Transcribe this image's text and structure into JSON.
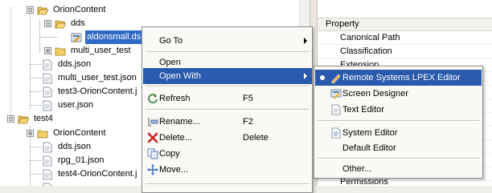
{
  "tree": {
    "items": [
      {
        "label": "OrionContent",
        "expander": "⊟",
        "icon": "folder-open-icon"
      },
      {
        "label": "dds",
        "expander": "⊟",
        "icon": "folder-open-icon"
      },
      {
        "label": "aldonsmall.ds",
        "icon": "dds-file-icon",
        "selected": true
      },
      {
        "label": "multi_user_test",
        "expander": "⊞",
        "icon": "folder-icon"
      },
      {
        "label": "dds.json",
        "icon": "json-file-icon"
      },
      {
        "label": "multi_user_test.json",
        "icon": "json-file-icon"
      },
      {
        "label": "test3-OrionContent.j",
        "icon": "json-file-icon"
      },
      {
        "label": "user.json",
        "icon": "json-file-icon"
      },
      {
        "label": "test4",
        "expander": "⊟",
        "icon": "folder-open-icon"
      },
      {
        "label": "OrionContent",
        "expander": "⊞",
        "icon": "folder-icon"
      },
      {
        "label": "dds.json",
        "icon": "json-file-icon"
      },
      {
        "label": "rpg_01.json",
        "icon": "json-file-icon"
      },
      {
        "label": "test4-OrionContent.j",
        "icon": "json-file-icon"
      }
    ]
  },
  "properties": {
    "header": "Property",
    "rows": [
      "Canonical Path",
      "Classification",
      "Extension",
      "",
      "",
      "",
      "",
      "",
      "",
      "",
      "",
      "Permissions"
    ]
  },
  "context_menu": {
    "items": [
      {
        "label": "Go To",
        "submenu": true
      },
      {
        "label": "Open"
      },
      {
        "label": "Open With",
        "submenu": true,
        "highlighted": true
      },
      {
        "label": "Refresh",
        "shortcut": "F5",
        "icon": "refresh-icon"
      },
      {
        "label": "Rename...",
        "shortcut": "F2",
        "icon": "rename-icon"
      },
      {
        "label": "Delete...",
        "shortcut": "Delete",
        "icon": "delete-icon"
      },
      {
        "label": "Copy",
        "icon": "copy-icon"
      },
      {
        "label": "Move...",
        "icon": "move-icon"
      }
    ]
  },
  "open_with_submenu": {
    "items": [
      {
        "label": "Remote Systems LPEX Editor",
        "highlighted": true,
        "checked": true,
        "icon": "lpex-editor-icon"
      },
      {
        "label": "Screen Designer",
        "icon": "screen-designer-icon"
      },
      {
        "label": "Text Editor",
        "icon": "text-editor-icon"
      },
      {
        "label": "System Editor",
        "icon": "system-editor-icon"
      },
      {
        "label": "Default Editor"
      },
      {
        "label": "Other..."
      }
    ]
  },
  "colors": {
    "selection": "#316ac5",
    "menu_highlight": "#2a5aad",
    "menu_background": "#faf9f5"
  }
}
